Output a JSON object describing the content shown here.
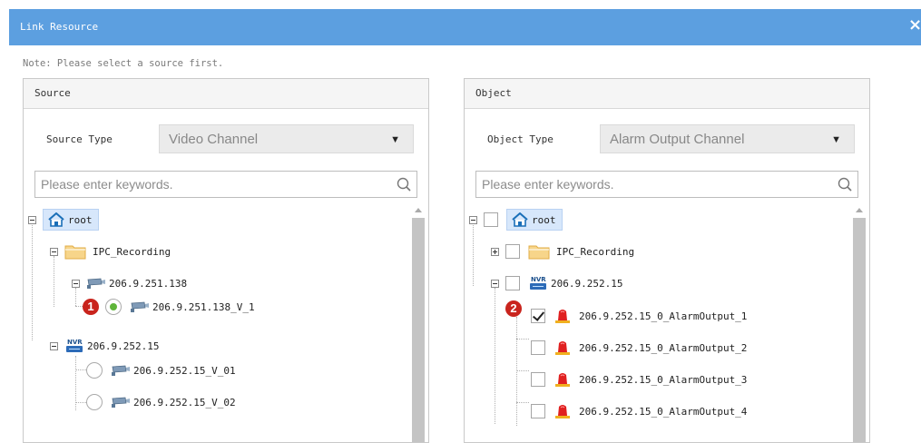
{
  "dialog": {
    "title": "Link Resource",
    "close_symbol": "×",
    "note": "Note: Please select a source first."
  },
  "source": {
    "header": "Source",
    "type_label": "Source Type",
    "type_value": "Video Channel",
    "search_placeholder": "Please enter keywords.",
    "tree": {
      "root": "root",
      "folder": "IPC_Recording",
      "ipc": "206.9.251.138",
      "ipc_channel": "206.9.251.138_V_1",
      "nvr_badge": "NVR",
      "nvr": "206.9.252.15",
      "nvr_channels": [
        "206.9.252.15_V_01",
        "206.9.252.15_V_02"
      ]
    },
    "step_badge": "1"
  },
  "object": {
    "header": "Object",
    "type_label": "Object Type",
    "type_value": "Alarm Output Channel",
    "search_placeholder": "Please enter keywords.",
    "tree": {
      "root": "root",
      "folder": "IPC_Recording",
      "nvr_badge": "NVR",
      "nvr": "206.9.252.15",
      "outputs": [
        "206.9.252.15_0_AlarmOutput_1",
        "206.9.252.15_0_AlarmOutput_2",
        "206.9.252.15_0_AlarmOutput_3",
        "206.9.252.15_0_AlarmOutput_4"
      ],
      "checked_output_index": 0
    },
    "step_badge": "2"
  },
  "colors": {
    "titlebar": "#5c9fe0",
    "badge": "#c9241d",
    "radio_selected": "#5fb53a",
    "root_highlight": "#d7e7fb"
  },
  "icons": [
    "home-icon",
    "folder-icon",
    "camera-icon",
    "nvr-icon",
    "alarm-light-icon",
    "search-icon",
    "dropdown-arrow-icon",
    "close-icon"
  ]
}
